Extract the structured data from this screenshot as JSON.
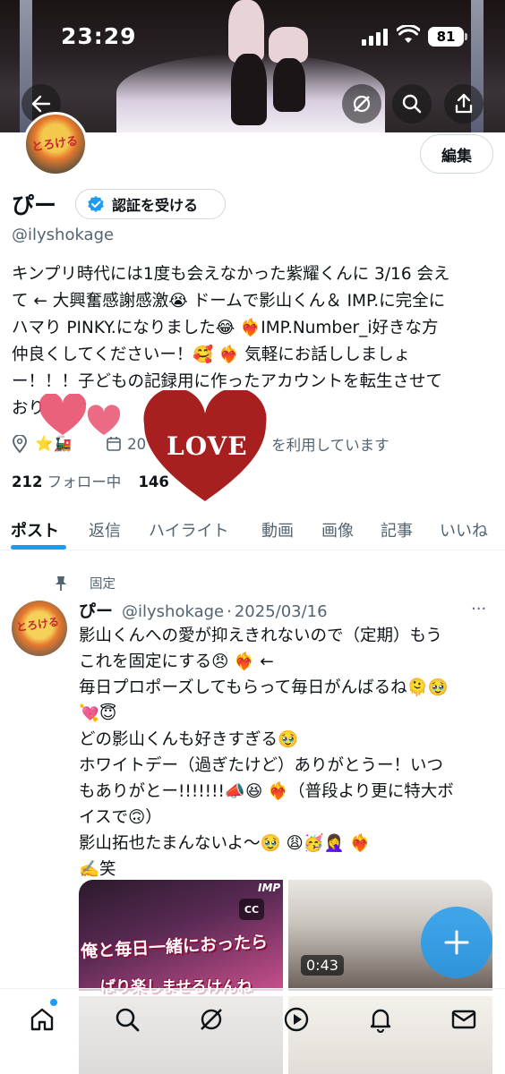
{
  "status_bar": {
    "time": "23:29",
    "battery": "81"
  },
  "header": {
    "back_icon": "arrow-left-icon",
    "actions": [
      "grok-icon",
      "search-icon",
      "share-icon"
    ]
  },
  "profile": {
    "avatar_text": "とろける",
    "edit_label": "編集",
    "name": "ぴー",
    "verify_label": "認証を受ける",
    "handle": "@ilyshokage",
    "bio_lines": [
      "キンプリ時代には1度も会えなかった紫耀くんに 3/16 会え",
      "て ← 大興奮感謝感激😭 ドームで影山くん＆ IMP.に完全に",
      "ハマり PINKY.になりました😂 ❤️‍🔥IMP.Number_i好きな方",
      "仲良くしてくださいー！🥰 ❤️‍🔥 気軽にお話ししましょ",
      "ー！！！子どもの記録用に作ったアカウントを転生させて",
      "おり"
    ],
    "meta_location": "⭐🚂",
    "meta_joined_prefix": "20",
    "meta_joined_suffix": "を利用しています",
    "following_count": "212",
    "following_label": "フォロー中",
    "followers_count": "146",
    "love_sticker": "LOVE"
  },
  "tabs": [
    {
      "label": "ポスト",
      "active": true
    },
    {
      "label": "返信",
      "active": false
    },
    {
      "label": "ハイライト",
      "active": false
    },
    {
      "label": "動画",
      "active": false
    },
    {
      "label": "画像",
      "active": false
    },
    {
      "label": "記事",
      "active": false
    },
    {
      "label": "いいね",
      "active": false
    }
  ],
  "post": {
    "pinned_label": "固定",
    "author_name": "ぴー",
    "author_handle": "@ilyshokage",
    "separator": "·",
    "date": "2025/03/16",
    "more": "···",
    "body_lines": [
      "影山くんへの愛が抑えきれないので（定期）もう",
      "これを固定にする😠 ❤️‍🔥 ←",
      "毎日プロポーズしてもらって毎日がんばるね🫠🥹",
      "💘😇",
      "どの影山くんも好きすぎる🥹",
      "ホワイトデー（過ぎたけど）ありがとうー！いつ",
      "もありがとー!!!!!!!📣😆 ❤️‍🔥（普段より更に特大ボ",
      "イスで🙃）",
      "影山拓也たまんないよ〜🥹 😩🥳🤦‍♀️ ❤️‍🔥",
      "✍️笑"
    ],
    "media": {
      "video1_brand": "IMP",
      "video1_cc": "CC",
      "video1_caption_1": "俺と毎日一緒におったら",
      "video1_caption_2": "ばり楽しませるけんね",
      "video2_duration": "0:43"
    }
  },
  "fab_icon": "plus-icon",
  "bottom_nav": [
    "home-icon",
    "search-icon",
    "grok-icon",
    "play-icon",
    "bell-icon",
    "mail-icon"
  ]
}
